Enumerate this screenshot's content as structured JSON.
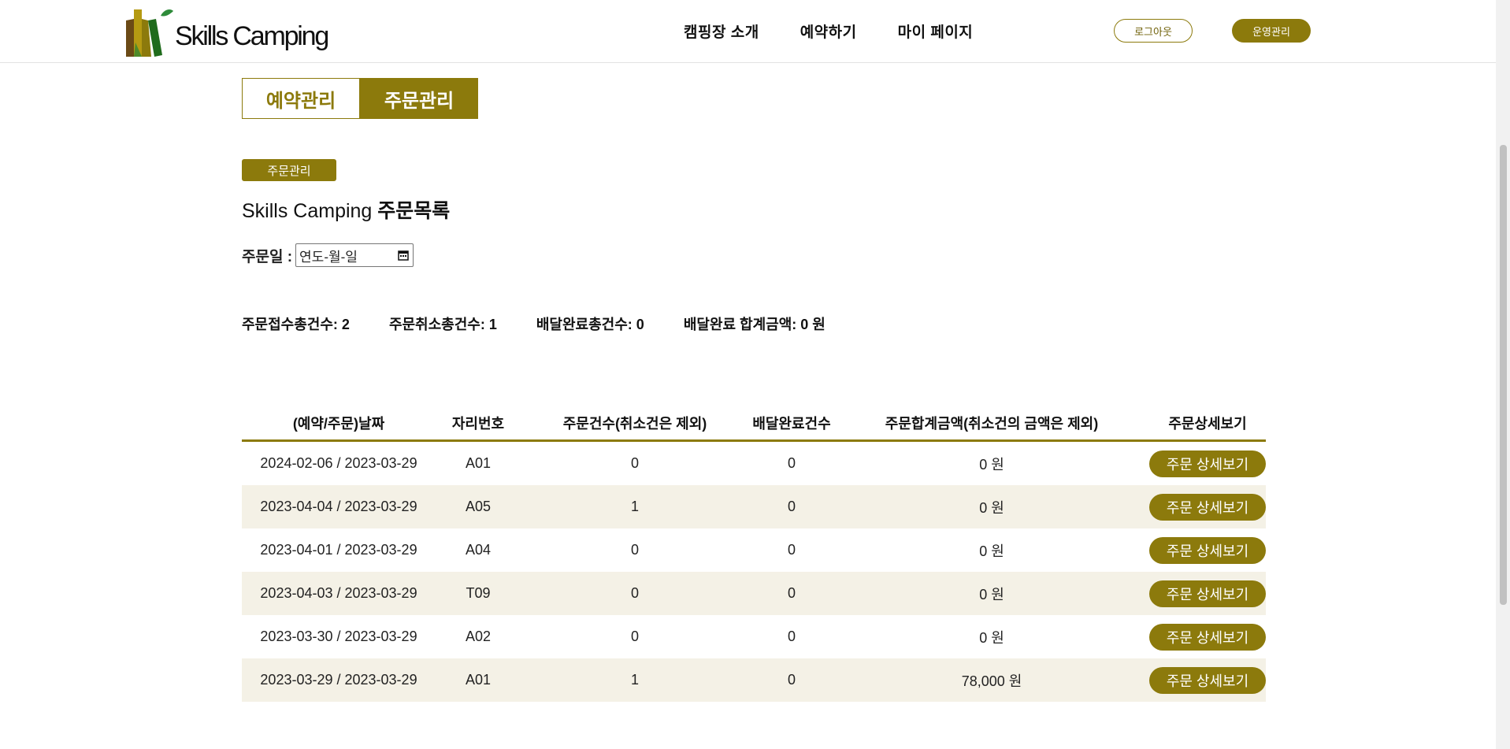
{
  "header": {
    "logo_text": "Skills Camping",
    "nav": [
      "캠핑장 소개",
      "예약하기",
      "마이 페이지"
    ],
    "logout_label": "로그아웃",
    "admin_label": "운영관리"
  },
  "tabs": [
    {
      "label": "예약관리",
      "active": false
    },
    {
      "label": "주문관리",
      "active": true
    }
  ],
  "section_pill": "주문관리",
  "title": {
    "prefix": "Skills Camping",
    "bold": "주문목록"
  },
  "date_filter": {
    "label": "주문일 :",
    "placeholder": "연도-월-일"
  },
  "stats": [
    "주문접수총건수: 2",
    "주문취소총건수: 1",
    "배달완료총건수: 0",
    "배달완료 합계금액: 0 원"
  ],
  "table": {
    "headers": [
      "(예약/주문)날짜",
      "자리번호",
      "주문건수(취소건은 제외)",
      "배달완료건수",
      "주문합계금액(취소건의 금액은 제외)",
      "주문상세보기"
    ],
    "button_label": "주문 상세보기",
    "rows": [
      [
        "2024-02-06 / 2023-03-29",
        "A01",
        "0",
        "0",
        "0 원"
      ],
      [
        "2023-04-04 / 2023-03-29",
        "A05",
        "1",
        "0",
        "0 원"
      ],
      [
        "2023-04-01 / 2023-03-29",
        "A04",
        "0",
        "0",
        "0 원"
      ],
      [
        "2023-04-03 / 2023-03-29",
        "T09",
        "0",
        "0",
        "0 원"
      ],
      [
        "2023-03-30 / 2023-03-29",
        "A02",
        "0",
        "0",
        "0 원"
      ],
      [
        "2023-03-29 / 2023-03-29",
        "A01",
        "1",
        "0",
        "78,000 원"
      ]
    ]
  },
  "colors": {
    "accent": "#8c7a0c",
    "row_alt": "#f4f1e6"
  }
}
